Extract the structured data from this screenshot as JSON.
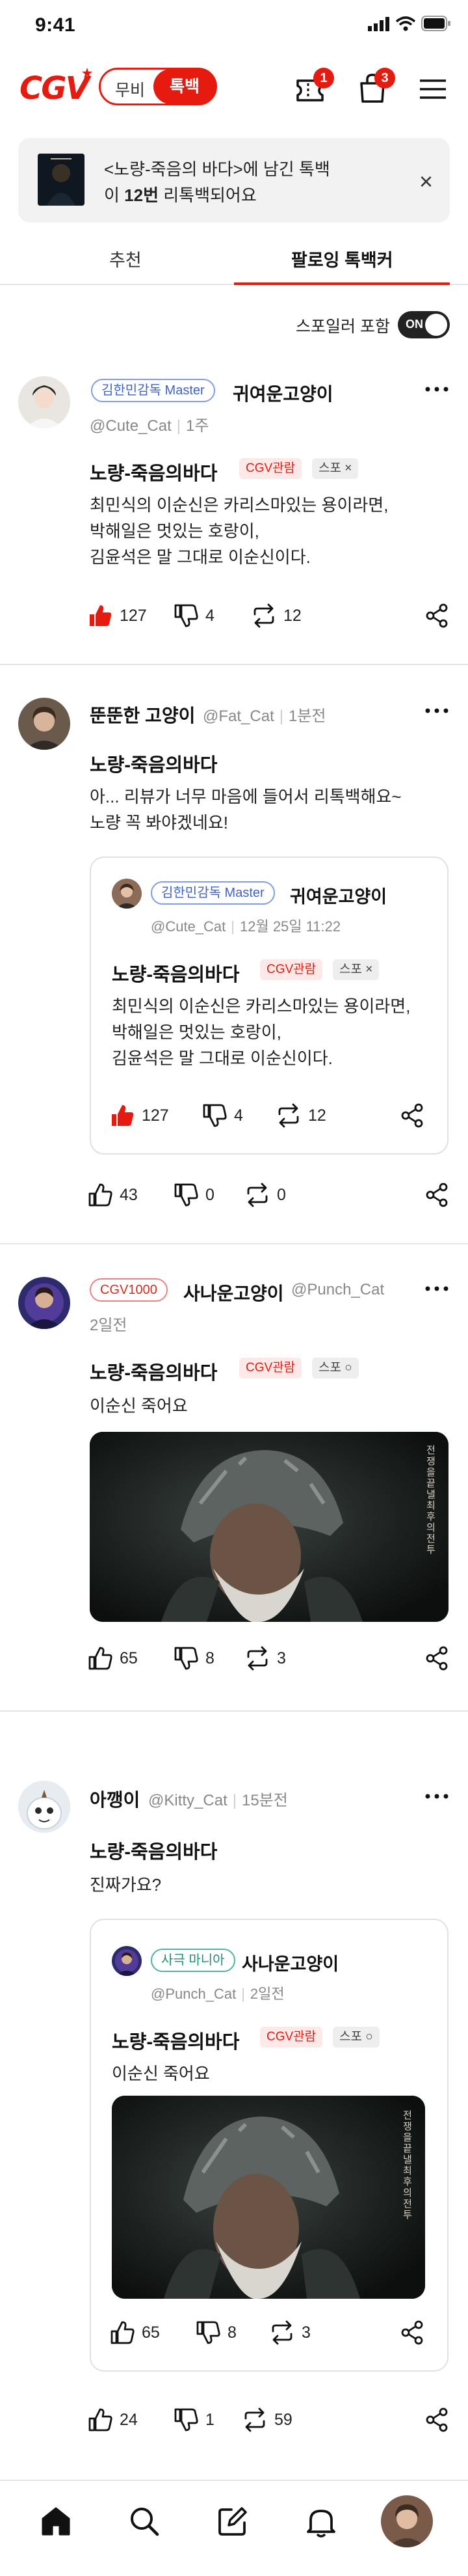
{
  "status_bar": {
    "time": "9:41"
  },
  "header": {
    "logo": "CGV",
    "toggle_off": "무비",
    "toggle_on": "톡백",
    "ticket_badge": "1",
    "cart_badge": "3"
  },
  "banner": {
    "line1": "<노량-죽음의 바다>에 남긴 톡백",
    "line2_pre": "이 ",
    "line2_bold": "12번",
    "line2_post": " 리톡백되어요",
    "close": "×"
  },
  "tabs": [
    {
      "label": "추천"
    },
    {
      "label": "팔로잉 톡백커"
    }
  ],
  "spoiler": {
    "label": "스포일러 포함",
    "switch": "ON"
  },
  "posts": [
    {
      "badge": "김한민감독 Master",
      "author": "귀여운고양이",
      "handle": "@Cute_Cat",
      "time": "1주",
      "movie": "노량-죽음의바다",
      "tag_cgv": "CGV관람",
      "tag_spoiler": "스포 ×",
      "lines": [
        "최민식의 이순신은 카리스마있는 용이라면,",
        "박해일은 멋있는 호랑이,",
        "김윤석은 말 그대로 이순신이다."
      ],
      "likes": "127",
      "dislikes": "4",
      "retalks": "12"
    },
    {
      "author": "뚠뚠한 고양이",
      "handle": "@Fat_Cat",
      "time": "1분전",
      "movie": "노량-죽음의바다",
      "lines": [
        "아... 리뷰가 너무 마음에 들어서 리톡백해요~",
        "노량 꼭 봐야겠네요!"
      ],
      "likes": "43",
      "dislikes": "0",
      "retalks": "0",
      "quote": {
        "badge": "김한민감독 Master",
        "author": "귀여운고양이",
        "handle": "@Cute_Cat",
        "time": "12월 25일 11:22",
        "movie": "노량-죽음의바다",
        "tag_cgv": "CGV관람",
        "tag_spoiler": "스포 ×",
        "lines": [
          "최민식의 이순신은 카리스마있는 용이라면,",
          "박해일은 멋있는 호랑이,",
          "김윤석은 말 그대로 이순신이다."
        ],
        "likes": "127",
        "dislikes": "4",
        "retalks": "12"
      }
    },
    {
      "badge": "CGV1000",
      "author": "사나운고양이",
      "handle": "@Punch_Cat",
      "time": "2일전",
      "movie": "노량-죽음의바다",
      "tag_cgv": "CGV관람",
      "tag_spoiler": "스포 ○",
      "lines": [
        "이순신 죽어요"
      ],
      "still_caption": "전쟁을 끝낼 최후의 전투",
      "likes": "65",
      "dislikes": "8",
      "retalks": "3"
    },
    {
      "author": "아깽이",
      "handle": "@Kitty_Cat",
      "time": "15분전",
      "movie": "노량-죽음의바다",
      "lines": [
        "진짜가요?"
      ],
      "likes": "24",
      "dislikes": "1",
      "retalks": "59",
      "quote": {
        "badge": "사극 마니아",
        "author": "사나운고양이",
        "handle": "@Punch_Cat",
        "time": "2일전",
        "movie": "노량-죽음의바다",
        "tag_cgv": "CGV관람",
        "tag_spoiler": "스포 ○",
        "lines": [
          "이순신 죽어요"
        ],
        "still_caption": "전쟁을 끝낼 최후의 전투",
        "likes": "65",
        "dislikes": "8",
        "retalks": "3"
      }
    }
  ],
  "colors": {
    "accent": "#e71a0f",
    "text": "#111111",
    "muted": "#888888"
  },
  "icons": [
    "wifi-icon",
    "signal-icon",
    "battery-icon",
    "ticket-icon",
    "bag-icon",
    "menu-icon",
    "thumb-up-icon",
    "thumb-down-icon",
    "retalk-icon",
    "share-icon",
    "home-icon",
    "search-icon",
    "write-icon",
    "bell-icon"
  ]
}
